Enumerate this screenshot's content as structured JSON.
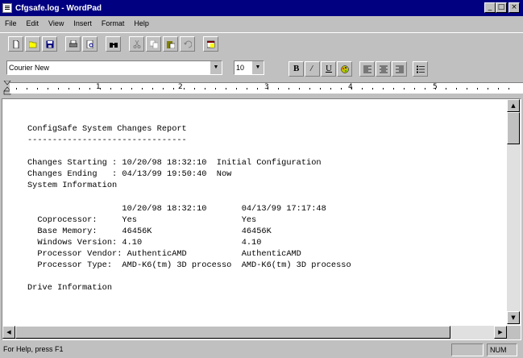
{
  "window": {
    "title": "Cfgsafe.log - WordPad"
  },
  "titlebar_buttons": {
    "minimize": "_",
    "maximize": "□",
    "close": "×"
  },
  "menu": [
    "File",
    "Edit",
    "View",
    "Insert",
    "Format",
    "Help"
  ],
  "toolbar": {
    "icons": [
      "new-icon",
      "open-icon",
      "save-icon",
      "print-icon",
      "print-preview-icon",
      "find-icon",
      "cut-icon",
      "copy-icon",
      "paste-icon",
      "undo-icon",
      "date-time-icon"
    ]
  },
  "format": {
    "font_name": "Courier New",
    "font_size": "10",
    "bold": "B",
    "italic": "/",
    "underline": "U"
  },
  "ruler": {
    "numbers": [
      "1",
      "2",
      "3",
      "4",
      "5"
    ]
  },
  "document": {
    "lines": [
      "ConfigSafe System Changes Report",
      "--------------------------------",
      "",
      "Changes Starting : 10/20/98 18:32:10  Initial Configuration",
      "Changes Ending   : 04/13/99 19:50:40  Now",
      "System Information",
      "",
      "                   10/20/98 18:32:10       04/13/99 17:17:48",
      "  Coprocessor:     Yes                     Yes",
      "  Base Memory:     46456K                  46456K",
      "  Windows Version: 4.10                    4.10",
      "  Processor Vendor: AuthenticAMD           AuthenticAMD",
      "  Processor Type:  AMD-K6(tm) 3D processo  AMD-K6(tm) 3D processo",
      "",
      "Drive Information"
    ]
  },
  "statusbar": {
    "message": "For Help, press F1",
    "num": "NUM"
  },
  "colors": {
    "titlebar": "#000080",
    "face": "#c0c0c0"
  }
}
